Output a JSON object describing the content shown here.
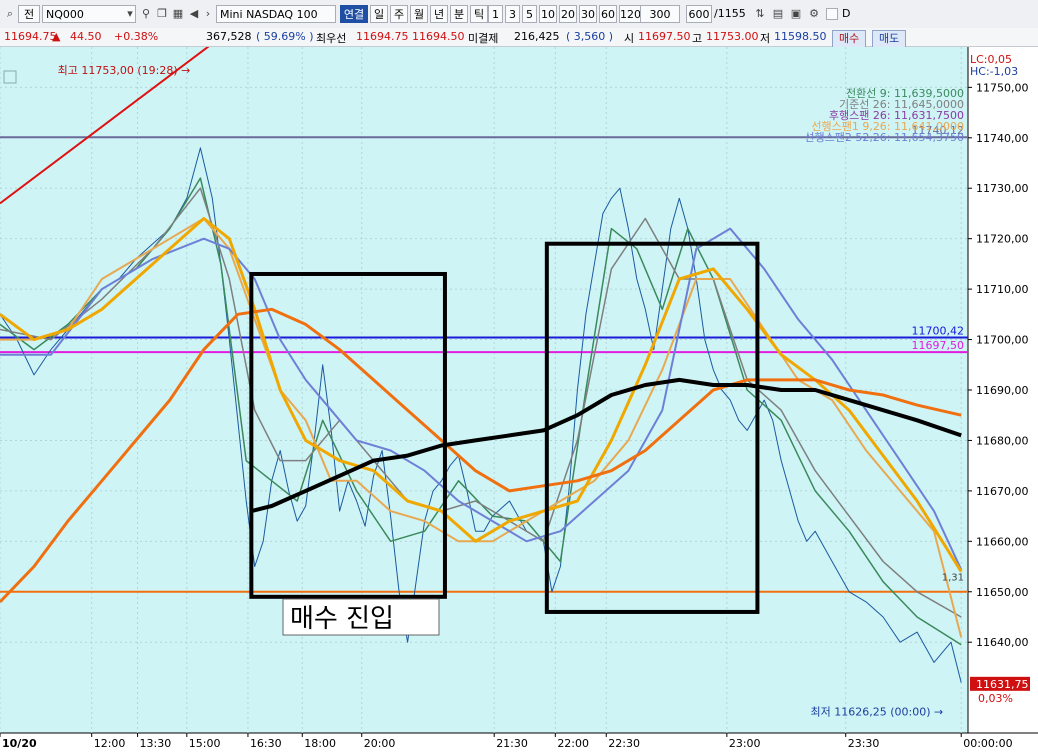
{
  "toolbar": {
    "type_label": "전",
    "symbol_code": "NQ000",
    "symbol_name": "Mini NASDAQ 100",
    "period_buttons": [
      "연결",
      "일",
      "주",
      "월",
      "년",
      "분",
      "틱"
    ],
    "period_selected": "연결",
    "interval_buttons": [
      "1",
      "3",
      "5",
      "10",
      "20",
      "30",
      "60",
      "120"
    ],
    "count_value": "300",
    "view_count": "600",
    "total_count": "/1155",
    "checkbox_label": "D"
  },
  "quote": {
    "price": "11694.75",
    "change_arrow": "▲",
    "change": "44.50",
    "change_pct": "+0.38%",
    "volume": "367,528",
    "volume_ratio": "( 59.69% )",
    "best_ask_label": "최우선",
    "best_ask": "11694.75",
    "best_bid": "11694.50",
    "open_interest_label": "미결제",
    "open_interest": "216,425",
    "open_interest_change": "( 3,560 )",
    "open_label": "시",
    "open": "11697.50",
    "high_label": "고",
    "high": "11753.00",
    "low_label": "저",
    "low": "11598.50",
    "buy_button": "매수",
    "sell_button": "매도"
  },
  "chart_data": {
    "type": "line",
    "title": "Mini NASDAQ 100",
    "y_axis": {
      "ticks": [
        11640,
        11650,
        11660,
        11670,
        11680,
        11690,
        11700,
        11710,
        11720,
        11730,
        11740,
        11750
      ],
      "tick_labels": [
        "11640,00",
        "11650,00",
        "11660,00",
        "11670,00",
        "11680,00",
        "11690,00",
        "11700,00",
        "11710,00",
        "11720,00",
        "11730,00",
        "11740,00",
        "11750,00"
      ],
      "range": [
        11622,
        11758
      ]
    },
    "x_axis": {
      "tick_labels": [
        "10/20",
        "12:00",
        "13:30",
        "15:00",
        "16:30",
        "18:00",
        "20:00",
        "21:30",
        "22:00",
        "22:30",
        "23:00",
        "23:30",
        "00:00:00"
      ],
      "ticks": [
        0,
        54,
        81,
        110,
        146,
        178,
        213,
        291,
        327,
        357,
        428,
        498,
        566
      ]
    },
    "x_range": [
      0,
      570
    ],
    "legend": [
      {
        "label": "전환선 9: 11,639,5000",
        "color": "#3a8a5c"
      },
      {
        "label": "기준선 26: 11,645,0000",
        "color": "#7f7f7f"
      },
      {
        "label": "후행스팬 26: 11,631,7500",
        "color": "#8b3aa4"
      },
      {
        "label": "선행스팬1 9,26: 11,641,0000",
        "color": "#e8a850"
      },
      {
        "label": "선행스팬2 52,26: 11,654,3750",
        "color": "#6e7fd6"
      }
    ],
    "left_scale": {
      "lc": "LC:0,05",
      "hc": "HC:-1,03"
    },
    "horizontal_lines": [
      {
        "value": 11740.12,
        "label": "11740,12",
        "color": "#6b6b9a"
      },
      {
        "value": 11700.42,
        "label": "11700,42",
        "color": "#1a1ad8"
      },
      {
        "value": 11697.5,
        "label": "11697,50",
        "color": "#e01ce0"
      },
      {
        "value": 11650,
        "label": "",
        "color": "#f07010"
      }
    ],
    "high_annotation": {
      "label": "최고 11753,00 (19:28)",
      "value": 11753,
      "x": 118
    },
    "low_annotation": {
      "label": "최저 11626,25 (00:00)",
      "value": 11626.25,
      "x": 566
    },
    "current_price_label": "11631,75",
    "current_change_label": "0,03%",
    "right_small_label": "1,31",
    "trendline": {
      "x": [
        0,
        150
      ],
      "y": [
        11727,
        11765
      ]
    },
    "boxes": [
      {
        "x": [
          148,
          262
        ],
        "y": [
          11649,
          11713
        ]
      },
      {
        "x": [
          322,
          446
        ],
        "y": [
          11646,
          11719
        ]
      }
    ],
    "box_text": "매수  진입",
    "series": [
      {
        "name": "price",
        "color": "#1a5aa0",
        "x": [
          0,
          10,
          20,
          30,
          40,
          50,
          60,
          70,
          80,
          90,
          100,
          110,
          118,
          125,
          130,
          135,
          140,
          145,
          150,
          155,
          160,
          165,
          170,
          175,
          180,
          185,
          190,
          195,
          200,
          205,
          210,
          215,
          220,
          225,
          230,
          235,
          240,
          245,
          250,
          255,
          260,
          265,
          270,
          275,
          280,
          285,
          290,
          300,
          310,
          320,
          325,
          330,
          335,
          340,
          345,
          350,
          355,
          360,
          365,
          370,
          375,
          380,
          385,
          390,
          395,
          400,
          405,
          410,
          415,
          420,
          425,
          430,
          435,
          440,
          445,
          450,
          455,
          460,
          465,
          470,
          475,
          480,
          490,
          500,
          510,
          520,
          530,
          540,
          550,
          560,
          566
        ],
        "y": [
          11705,
          11700,
          11693,
          11698,
          11702,
          11706,
          11710,
          11712,
          11716,
          11719,
          11722,
          11728,
          11738,
          11728,
          11715,
          11700,
          11684,
          11668,
          11655,
          11660,
          11672,
          11678,
          11670,
          11664,
          11667,
          11680,
          11695,
          11682,
          11666,
          11672,
          11668,
          11663,
          11673,
          11678,
          11665,
          11650,
          11640,
          11652,
          11664,
          11670,
          11672,
          11675,
          11677,
          11670,
          11662,
          11662,
          11665,
          11668,
          11662,
          11660,
          11650,
          11655,
          11670,
          11690,
          11705,
          11715,
          11725,
          11728,
          11730,
          11722,
          11712,
          11706,
          11698,
          11710,
          11722,
          11728,
          11722,
          11712,
          11700,
          11694,
          11690,
          11688,
          11684,
          11682,
          11685,
          11688,
          11684,
          11676,
          11670,
          11664,
          11660,
          11662,
          11656,
          11650,
          11648,
          11645,
          11640,
          11642,
          11636,
          11640,
          11632
        ]
      },
      {
        "name": "전환선 9",
        "color": "#3a8a5c",
        "x": [
          0,
          20,
          40,
          60,
          80,
          100,
          118,
          130,
          145,
          160,
          175,
          190,
          210,
          230,
          250,
          270,
          290,
          310,
          330,
          345,
          360,
          375,
          390,
          405,
          420,
          440,
          460,
          480,
          500,
          520,
          540,
          566
        ],
        "y": [
          11703,
          11698,
          11703,
          11710,
          11714,
          11722,
          11732,
          11715,
          11676,
          11672,
          11668,
          11684,
          11670,
          11660,
          11662,
          11672,
          11665,
          11664,
          11656,
          11690,
          11722,
          11718,
          11706,
          11722,
          11712,
          11690,
          11684,
          11670,
          11662,
          11652,
          11645,
          11639.5
        ]
      },
      {
        "name": "기준선 26",
        "color": "#7f7f7f",
        "x": [
          0,
          30,
          60,
          90,
          118,
          135,
          150,
          165,
          180,
          200,
          220,
          240,
          260,
          280,
          300,
          320,
          340,
          360,
          380,
          400,
          420,
          440,
          460,
          480,
          500,
          520,
          540,
          566
        ],
        "y": [
          11702,
          11700,
          11708,
          11718,
          11730,
          11712,
          11686,
          11676,
          11676,
          11684,
          11676,
          11668,
          11666,
          11668,
          11664,
          11660,
          11680,
          11714,
          11724,
          11712,
          11712,
          11692,
          11686,
          11674,
          11665,
          11656,
          11650,
          11645
        ]
      },
      {
        "name": "선행스팬1 9,26",
        "color": "#e8a850",
        "x": [
          0,
          20,
          40,
          60,
          80,
          100,
          120,
          135,
          150,
          165,
          180,
          195,
          210,
          230,
          250,
          270,
          290,
          310,
          330,
          350,
          370,
          390,
          410,
          430,
          450,
          470,
          490,
          510,
          530,
          550,
          566
        ],
        "y": [
          11700,
          11700,
          11702,
          11712,
          11716,
          11720,
          11724,
          11718,
          11704,
          11690,
          11684,
          11672,
          11672,
          11666,
          11664,
          11660,
          11660,
          11664,
          11668,
          11672,
          11680,
          11694,
          11712,
          11712,
          11702,
          11692,
          11688,
          11678,
          11670,
          11662,
          11641
        ]
      },
      {
        "name": "선행스팬2 52,26",
        "color": "#6e7fd6",
        "x": [
          0,
          30,
          60,
          90,
          120,
          135,
          150,
          165,
          180,
          195,
          210,
          230,
          250,
          270,
          290,
          310,
          330,
          350,
          370,
          390,
          410,
          430,
          450,
          470,
          490,
          510,
          530,
          550,
          566
        ],
        "y": [
          11697,
          11697,
          11710,
          11716,
          11720,
          11718,
          11712,
          11700,
          11692,
          11686,
          11680,
          11678,
          11674,
          11668,
          11664,
          11660,
          11662,
          11668,
          11674,
          11686,
          11718,
          11722,
          11714,
          11704,
          11696,
          11686,
          11676,
          11666,
          11654.4
        ]
      },
      {
        "name": "MA mid",
        "color": "#f0a800",
        "x": [
          0,
          20,
          40,
          60,
          80,
          100,
          120,
          135,
          150,
          165,
          180,
          200,
          220,
          240,
          260,
          280,
          300,
          320,
          340,
          360,
          380,
          400,
          420,
          440,
          460,
          480,
          500,
          520,
          540,
          566
        ],
        "y": [
          11705,
          11700,
          11702,
          11706,
          11712,
          11718,
          11724,
          11720,
          11706,
          11690,
          11680,
          11676,
          11674,
          11668,
          11666,
          11660,
          11664,
          11666,
          11668,
          11680,
          11695,
          11712,
          11714,
          11706,
          11697,
          11692,
          11686,
          11677,
          11668,
          11654
        ]
      },
      {
        "name": "MA long",
        "color": "#f07010",
        "x": [
          0,
          20,
          40,
          60,
          80,
          100,
          120,
          140,
          160,
          180,
          200,
          220,
          240,
          260,
          280,
          300,
          320,
          340,
          360,
          380,
          400,
          420,
          440,
          460,
          480,
          500,
          520,
          540,
          566
        ],
        "y": [
          11648,
          11655,
          11664,
          11672,
          11680,
          11688,
          11698,
          11705,
          11706,
          11703,
          11698,
          11692,
          11686,
          11680,
          11674,
          11670,
          11671,
          11672,
          11674,
          11678,
          11684,
          11690,
          11692,
          11692,
          11692,
          11690,
          11689,
          11687,
          11685
        ]
      },
      {
        "name": "MA black",
        "color": "#000000",
        "x": [
          148,
          160,
          180,
          200,
          220,
          240,
          260,
          280,
          300,
          320,
          340,
          360,
          380,
          400,
          420,
          440,
          460,
          480,
          500,
          520,
          540,
          566
        ],
        "y": [
          11666,
          11667,
          11670,
          11673,
          11676,
          11677,
          11679,
          11680,
          11681,
          11682,
          11685,
          11689,
          11691,
          11692,
          11691,
          11691,
          11690,
          11690,
          11688,
          11686,
          11684,
          11681
        ]
      }
    ]
  }
}
